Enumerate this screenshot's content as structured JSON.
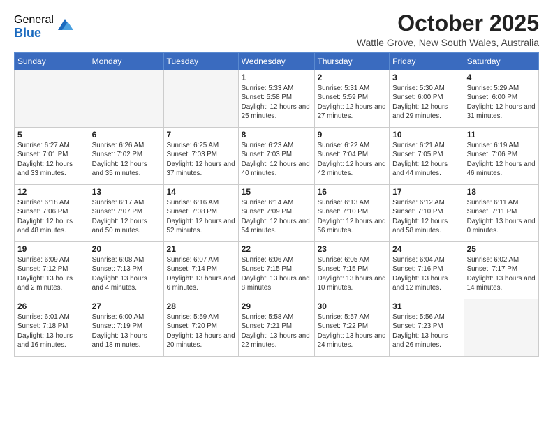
{
  "logo": {
    "general": "General",
    "blue": "Blue"
  },
  "title": "October 2025",
  "location": "Wattle Grove, New South Wales, Australia",
  "days_of_week": [
    "Sunday",
    "Monday",
    "Tuesday",
    "Wednesday",
    "Thursday",
    "Friday",
    "Saturday"
  ],
  "weeks": [
    [
      {
        "day": "",
        "sunrise": "",
        "sunset": "",
        "daylight": ""
      },
      {
        "day": "",
        "sunrise": "",
        "sunset": "",
        "daylight": ""
      },
      {
        "day": "",
        "sunrise": "",
        "sunset": "",
        "daylight": ""
      },
      {
        "day": "1",
        "sunrise": "Sunrise: 5:33 AM",
        "sunset": "Sunset: 5:58 PM",
        "daylight": "Daylight: 12 hours and 25 minutes."
      },
      {
        "day": "2",
        "sunrise": "Sunrise: 5:31 AM",
        "sunset": "Sunset: 5:59 PM",
        "daylight": "Daylight: 12 hours and 27 minutes."
      },
      {
        "day": "3",
        "sunrise": "Sunrise: 5:30 AM",
        "sunset": "Sunset: 6:00 PM",
        "daylight": "Daylight: 12 hours and 29 minutes."
      },
      {
        "day": "4",
        "sunrise": "Sunrise: 5:29 AM",
        "sunset": "Sunset: 6:00 PM",
        "daylight": "Daylight: 12 hours and 31 minutes."
      }
    ],
    [
      {
        "day": "5",
        "sunrise": "Sunrise: 6:27 AM",
        "sunset": "Sunset: 7:01 PM",
        "daylight": "Daylight: 12 hours and 33 minutes."
      },
      {
        "day": "6",
        "sunrise": "Sunrise: 6:26 AM",
        "sunset": "Sunset: 7:02 PM",
        "daylight": "Daylight: 12 hours and 35 minutes."
      },
      {
        "day": "7",
        "sunrise": "Sunrise: 6:25 AM",
        "sunset": "Sunset: 7:03 PM",
        "daylight": "Daylight: 12 hours and 37 minutes."
      },
      {
        "day": "8",
        "sunrise": "Sunrise: 6:23 AM",
        "sunset": "Sunset: 7:03 PM",
        "daylight": "Daylight: 12 hours and 40 minutes."
      },
      {
        "day": "9",
        "sunrise": "Sunrise: 6:22 AM",
        "sunset": "Sunset: 7:04 PM",
        "daylight": "Daylight: 12 hours and 42 minutes."
      },
      {
        "day": "10",
        "sunrise": "Sunrise: 6:21 AM",
        "sunset": "Sunset: 7:05 PM",
        "daylight": "Daylight: 12 hours and 44 minutes."
      },
      {
        "day": "11",
        "sunrise": "Sunrise: 6:19 AM",
        "sunset": "Sunset: 7:06 PM",
        "daylight": "Daylight: 12 hours and 46 minutes."
      }
    ],
    [
      {
        "day": "12",
        "sunrise": "Sunrise: 6:18 AM",
        "sunset": "Sunset: 7:06 PM",
        "daylight": "Daylight: 12 hours and 48 minutes."
      },
      {
        "day": "13",
        "sunrise": "Sunrise: 6:17 AM",
        "sunset": "Sunset: 7:07 PM",
        "daylight": "Daylight: 12 hours and 50 minutes."
      },
      {
        "day": "14",
        "sunrise": "Sunrise: 6:16 AM",
        "sunset": "Sunset: 7:08 PM",
        "daylight": "Daylight: 12 hours and 52 minutes."
      },
      {
        "day": "15",
        "sunrise": "Sunrise: 6:14 AM",
        "sunset": "Sunset: 7:09 PM",
        "daylight": "Daylight: 12 hours and 54 minutes."
      },
      {
        "day": "16",
        "sunrise": "Sunrise: 6:13 AM",
        "sunset": "Sunset: 7:10 PM",
        "daylight": "Daylight: 12 hours and 56 minutes."
      },
      {
        "day": "17",
        "sunrise": "Sunrise: 6:12 AM",
        "sunset": "Sunset: 7:10 PM",
        "daylight": "Daylight: 12 hours and 58 minutes."
      },
      {
        "day": "18",
        "sunrise": "Sunrise: 6:11 AM",
        "sunset": "Sunset: 7:11 PM",
        "daylight": "Daylight: 13 hours and 0 minutes."
      }
    ],
    [
      {
        "day": "19",
        "sunrise": "Sunrise: 6:09 AM",
        "sunset": "Sunset: 7:12 PM",
        "daylight": "Daylight: 13 hours and 2 minutes."
      },
      {
        "day": "20",
        "sunrise": "Sunrise: 6:08 AM",
        "sunset": "Sunset: 7:13 PM",
        "daylight": "Daylight: 13 hours and 4 minutes."
      },
      {
        "day": "21",
        "sunrise": "Sunrise: 6:07 AM",
        "sunset": "Sunset: 7:14 PM",
        "daylight": "Daylight: 13 hours and 6 minutes."
      },
      {
        "day": "22",
        "sunrise": "Sunrise: 6:06 AM",
        "sunset": "Sunset: 7:15 PM",
        "daylight": "Daylight: 13 hours and 8 minutes."
      },
      {
        "day": "23",
        "sunrise": "Sunrise: 6:05 AM",
        "sunset": "Sunset: 7:15 PM",
        "daylight": "Daylight: 13 hours and 10 minutes."
      },
      {
        "day": "24",
        "sunrise": "Sunrise: 6:04 AM",
        "sunset": "Sunset: 7:16 PM",
        "daylight": "Daylight: 13 hours and 12 minutes."
      },
      {
        "day": "25",
        "sunrise": "Sunrise: 6:02 AM",
        "sunset": "Sunset: 7:17 PM",
        "daylight": "Daylight: 13 hours and 14 minutes."
      }
    ],
    [
      {
        "day": "26",
        "sunrise": "Sunrise: 6:01 AM",
        "sunset": "Sunset: 7:18 PM",
        "daylight": "Daylight: 13 hours and 16 minutes."
      },
      {
        "day": "27",
        "sunrise": "Sunrise: 6:00 AM",
        "sunset": "Sunset: 7:19 PM",
        "daylight": "Daylight: 13 hours and 18 minutes."
      },
      {
        "day": "28",
        "sunrise": "Sunrise: 5:59 AM",
        "sunset": "Sunset: 7:20 PM",
        "daylight": "Daylight: 13 hours and 20 minutes."
      },
      {
        "day": "29",
        "sunrise": "Sunrise: 5:58 AM",
        "sunset": "Sunset: 7:21 PM",
        "daylight": "Daylight: 13 hours and 22 minutes."
      },
      {
        "day": "30",
        "sunrise": "Sunrise: 5:57 AM",
        "sunset": "Sunset: 7:22 PM",
        "daylight": "Daylight: 13 hours and 24 minutes."
      },
      {
        "day": "31",
        "sunrise": "Sunrise: 5:56 AM",
        "sunset": "Sunset: 7:23 PM",
        "daylight": "Daylight: 13 hours and 26 minutes."
      },
      {
        "day": "",
        "sunrise": "",
        "sunset": "",
        "daylight": ""
      }
    ]
  ]
}
